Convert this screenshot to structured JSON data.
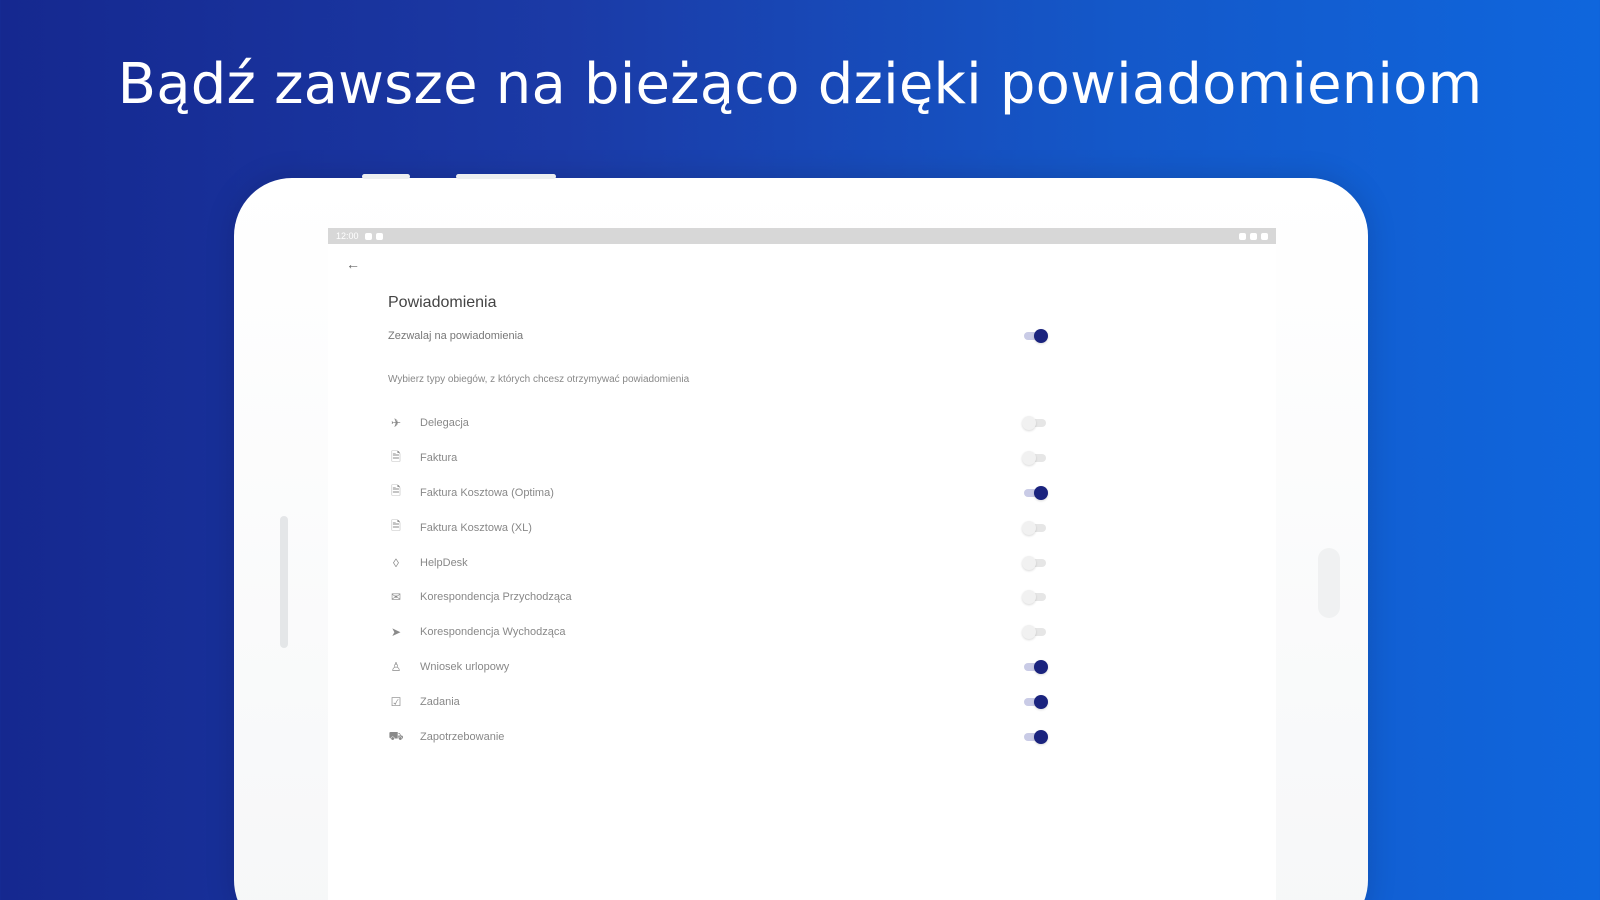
{
  "headline": "Bądź zawsze na bieżąco dzięki powiadomieniom",
  "colors": {
    "accent": "#1a237e",
    "background_start": "#15288f",
    "background_end": "#0f66dd"
  },
  "status_bar": {
    "time": "12:00"
  },
  "screen": {
    "back_icon": "arrow-left-icon",
    "title": "Powiadomienia",
    "allow": {
      "label": "Zezwalaj na powiadomienia",
      "on": true
    },
    "hint": "Wybierz typy obiegów, z których chcesz otrzymywać powiadomienia",
    "items": [
      {
        "label": "Delegacja",
        "icon": "plane-icon",
        "glyph": "✈",
        "on": false
      },
      {
        "label": "Faktura",
        "icon": "document-icon",
        "glyph": "🗎",
        "on": false
      },
      {
        "label": "Faktura Kosztowa (Optima)",
        "icon": "document-icon",
        "glyph": "🗎",
        "on": true
      },
      {
        "label": "Faktura Kosztowa (XL)",
        "icon": "document-icon",
        "glyph": "🗎",
        "on": false
      },
      {
        "label": "HelpDesk",
        "icon": "bulb-icon",
        "glyph": "◊",
        "on": false
      },
      {
        "label": "Korespondencja Przychodząca",
        "icon": "inbox-icon",
        "glyph": "✉",
        "on": false
      },
      {
        "label": "Korespondencja Wychodząca",
        "icon": "send-icon",
        "glyph": "➤",
        "on": false
      },
      {
        "label": "Wniosek urlopowy",
        "icon": "person-icon",
        "glyph": "♙",
        "on": true
      },
      {
        "label": "Zadania",
        "icon": "checkbox-icon",
        "glyph": "☑",
        "on": true
      },
      {
        "label": "Zapotrzebowanie",
        "icon": "cart-icon",
        "glyph": "⛟",
        "on": true
      }
    ]
  }
}
